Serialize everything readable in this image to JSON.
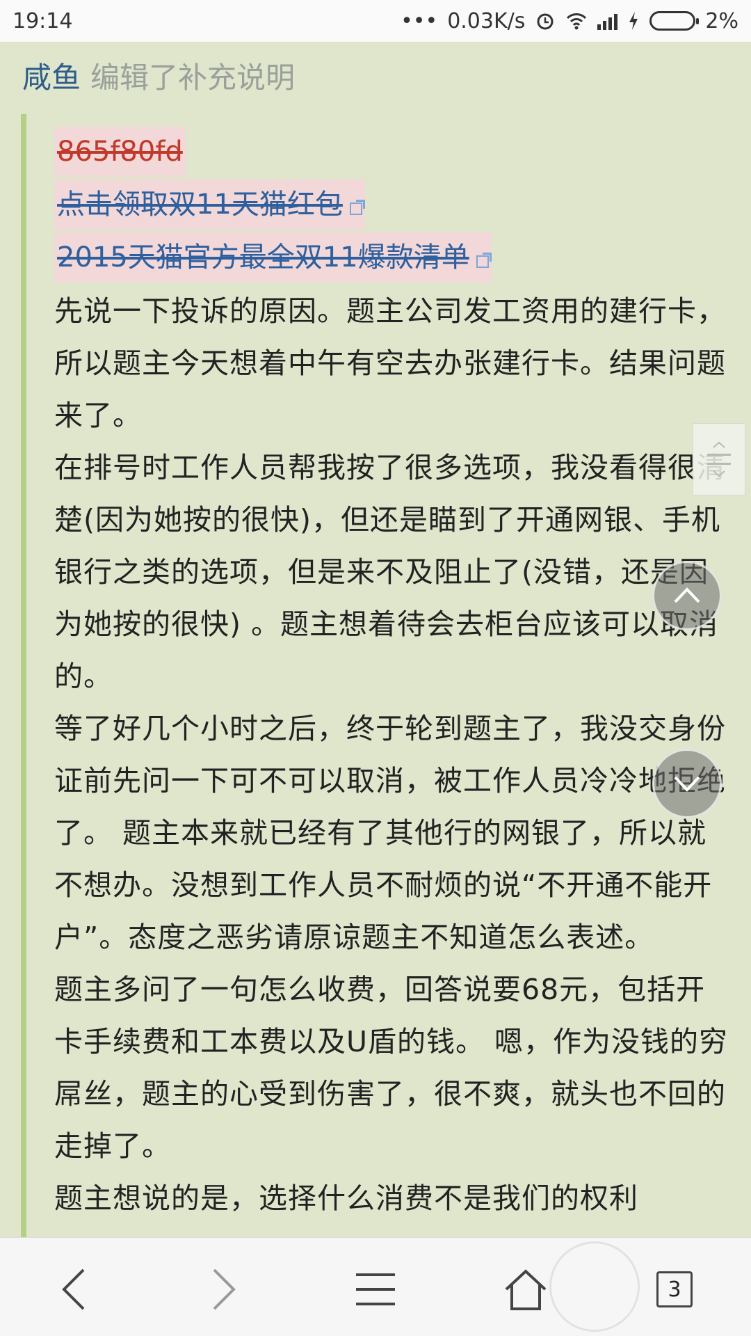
{
  "status_bar": {
    "time": "19:14",
    "network_speed": "0.03K/s",
    "battery": "2%",
    "icons": [
      "dots-icon",
      "alarm-icon",
      "wifi-icon",
      "signal-icon",
      "charging-icon",
      "battery-icon"
    ]
  },
  "editor": {
    "name": "咸鱼",
    "action": "编辑了补充说明"
  },
  "deleted_lines": [
    {
      "text": "865f80fd",
      "color": "red",
      "external": false
    },
    {
      "text": "点击领取双11天猫红包",
      "color": "blue",
      "external": true
    },
    {
      "text": "2015天猫官方最全双11爆款清单",
      "color": "blue",
      "external": true
    }
  ],
  "paragraphs": [
    "先说一下投诉的原因。题主公司发工资用的建行卡，所以题主今天想着中午有空去办张建行卡。结果问题来了。",
    "在排号时工作人员帮我按了很多选项，我没看得很清楚(因为她按的很快)，但还是瞄到了开通网银、手机银行之类的选项，但是来不及阻止了(没错，还是因为她按的很快) 。题主想着待会去柜台应该可以取消的。",
    "等了好几个小时之后，终于轮到题主了，我没交身份证前先问一下可不可以取消，被工作人员冷冷地拒绝了。 题主本来就已经有了其他行的网银了，所以就不想办。没想到工作人员不耐烦的说“不开通不能开户”。态度之恶劣请原谅题主不知道怎么表述。",
    "题主多问了一句怎么收费，回答说要68元，包括开卡手续费和工本费以及U盾的钱。 嗯，作为没钱的穷屌丝，题主的心受到伤害了，很不爽，就头也不回的走掉了。",
    "题主想说的是，选择什么消费不是我们的权利"
  ],
  "bottom_nav": {
    "tab_count": "3",
    "icons": [
      "back-icon",
      "forward-icon",
      "menu-icon",
      "home-icon",
      "tabs-icon"
    ]
  },
  "colors": {
    "background": "#dfe6cc",
    "quote_bar": "#b6cf86",
    "link_blue": "#2e5f9e",
    "deleted_red": "#c0392b",
    "deleted_bg": "#f2d8d8"
  }
}
